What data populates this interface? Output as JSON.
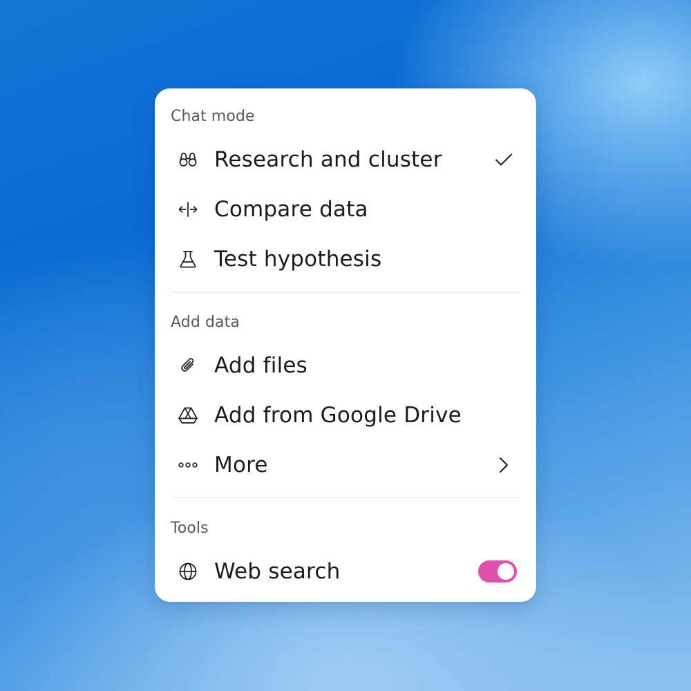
{
  "background": {
    "colors": [
      "#0a6ad3",
      "#8cc2f0"
    ]
  },
  "menu": {
    "sections": {
      "chat_mode": {
        "label": "Chat mode",
        "items": [
          {
            "label": "Research and cluster",
            "icon": "binoculars-icon",
            "selected": true
          },
          {
            "label": "Compare data",
            "icon": "compare-arrows-icon",
            "selected": false
          },
          {
            "label": "Test hypothesis",
            "icon": "flask-icon",
            "selected": false
          }
        ]
      },
      "add_data": {
        "label": "Add data",
        "items": [
          {
            "label": "Add files",
            "icon": "paperclip-icon"
          },
          {
            "label": "Add from Google Drive",
            "icon": "google-drive-icon"
          },
          {
            "label": "More",
            "icon": "more-dots-icon",
            "has_submenu": true
          }
        ]
      },
      "tools": {
        "label": "Tools",
        "items": [
          {
            "label": "Web search",
            "icon": "globe-icon",
            "enabled": true
          }
        ]
      }
    },
    "accent_color": "#e04fa8"
  }
}
